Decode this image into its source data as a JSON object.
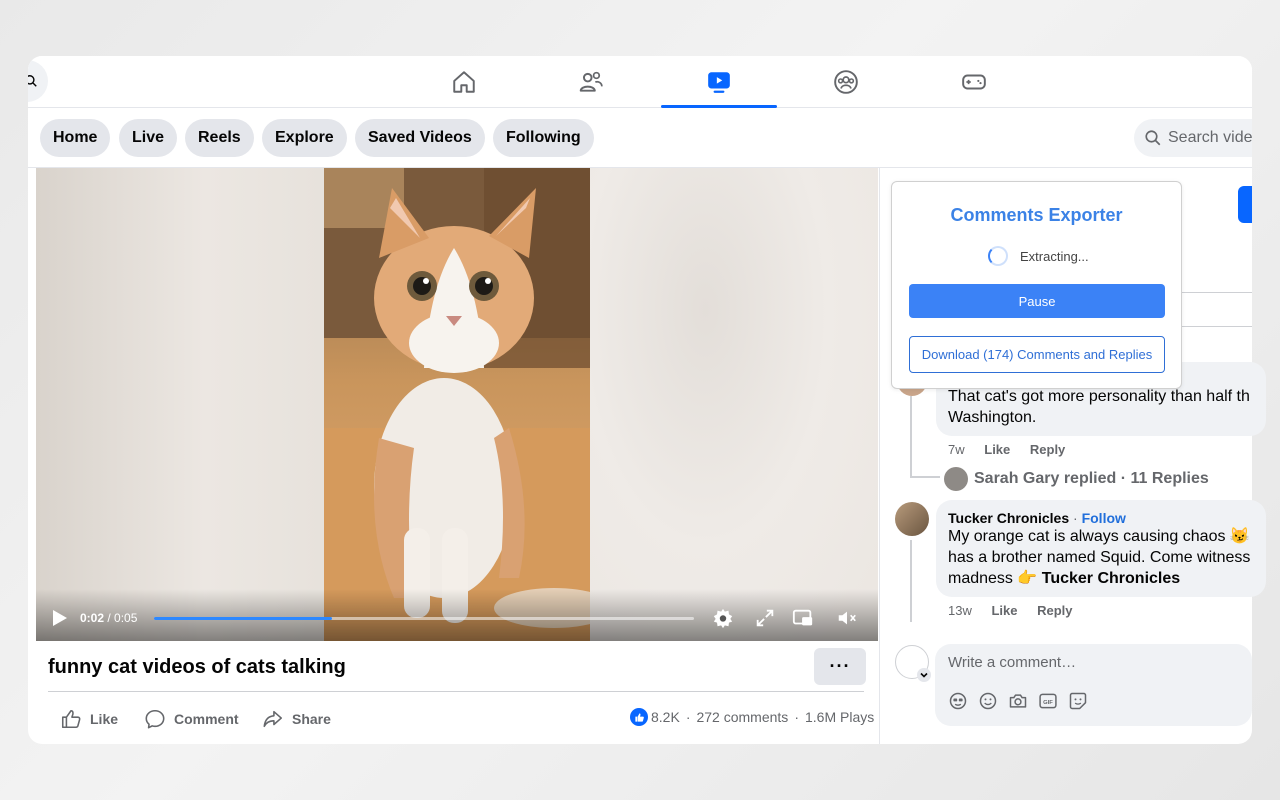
{
  "nav": {
    "tabs": [
      {
        "name": "home-icon"
      },
      {
        "name": "friends-icon"
      },
      {
        "name": "video-icon",
        "active": true
      },
      {
        "name": "groups-icon"
      },
      {
        "name": "gaming-icon"
      }
    ]
  },
  "video_pills": [
    "Home",
    "Live",
    "Reels",
    "Explore",
    "Saved Videos",
    "Following"
  ],
  "video_search": {
    "placeholder": "Search videos"
  },
  "player": {
    "current_time": "0:02",
    "duration": "/ 0:05",
    "progress_fraction": 0.33
  },
  "video": {
    "title": "funny cat videos of cats talking",
    "more_label": "···",
    "actions": {
      "like": "Like",
      "comment": "Comment",
      "share": "Share"
    },
    "likes": "8.2K",
    "comments": "272 comments",
    "plays": "1.6M Plays",
    "separator": "·"
  },
  "exporter": {
    "title": "Comments Exporter",
    "status": "Extracting...",
    "pause_label": "Pause",
    "download_label": "Download (174) Comments and Replies"
  },
  "comments": [
    {
      "text_line1": "That cat's got more personality than half th",
      "text_line2": "Washington.",
      "time": "7w",
      "like": "Like",
      "reply": "Reply",
      "replies_summary": "Sarah Gary replied · 11 Replies"
    },
    {
      "author": "Tucker Chronicles",
      "follow_sep": " · ",
      "follow": "Follow",
      "text_line1": "My orange cat is always causing chaos 😼",
      "text_line2": "has a brother named Squid. Come witness",
      "text_line3a": "madness 👉 ",
      "text_line3b": "Tucker Chronicles",
      "time": "13w",
      "like": "Like",
      "reply": "Reply"
    }
  ],
  "composer": {
    "placeholder": "Write a comment…",
    "tools": [
      "avatar-sticker-icon",
      "emoji-icon",
      "camera-icon",
      "gif-icon",
      "sticker-icon"
    ]
  },
  "colors": {
    "brand_blue": "#0866ff",
    "exporter_blue": "#3b82f6",
    "link_blue": "#216fdb"
  }
}
